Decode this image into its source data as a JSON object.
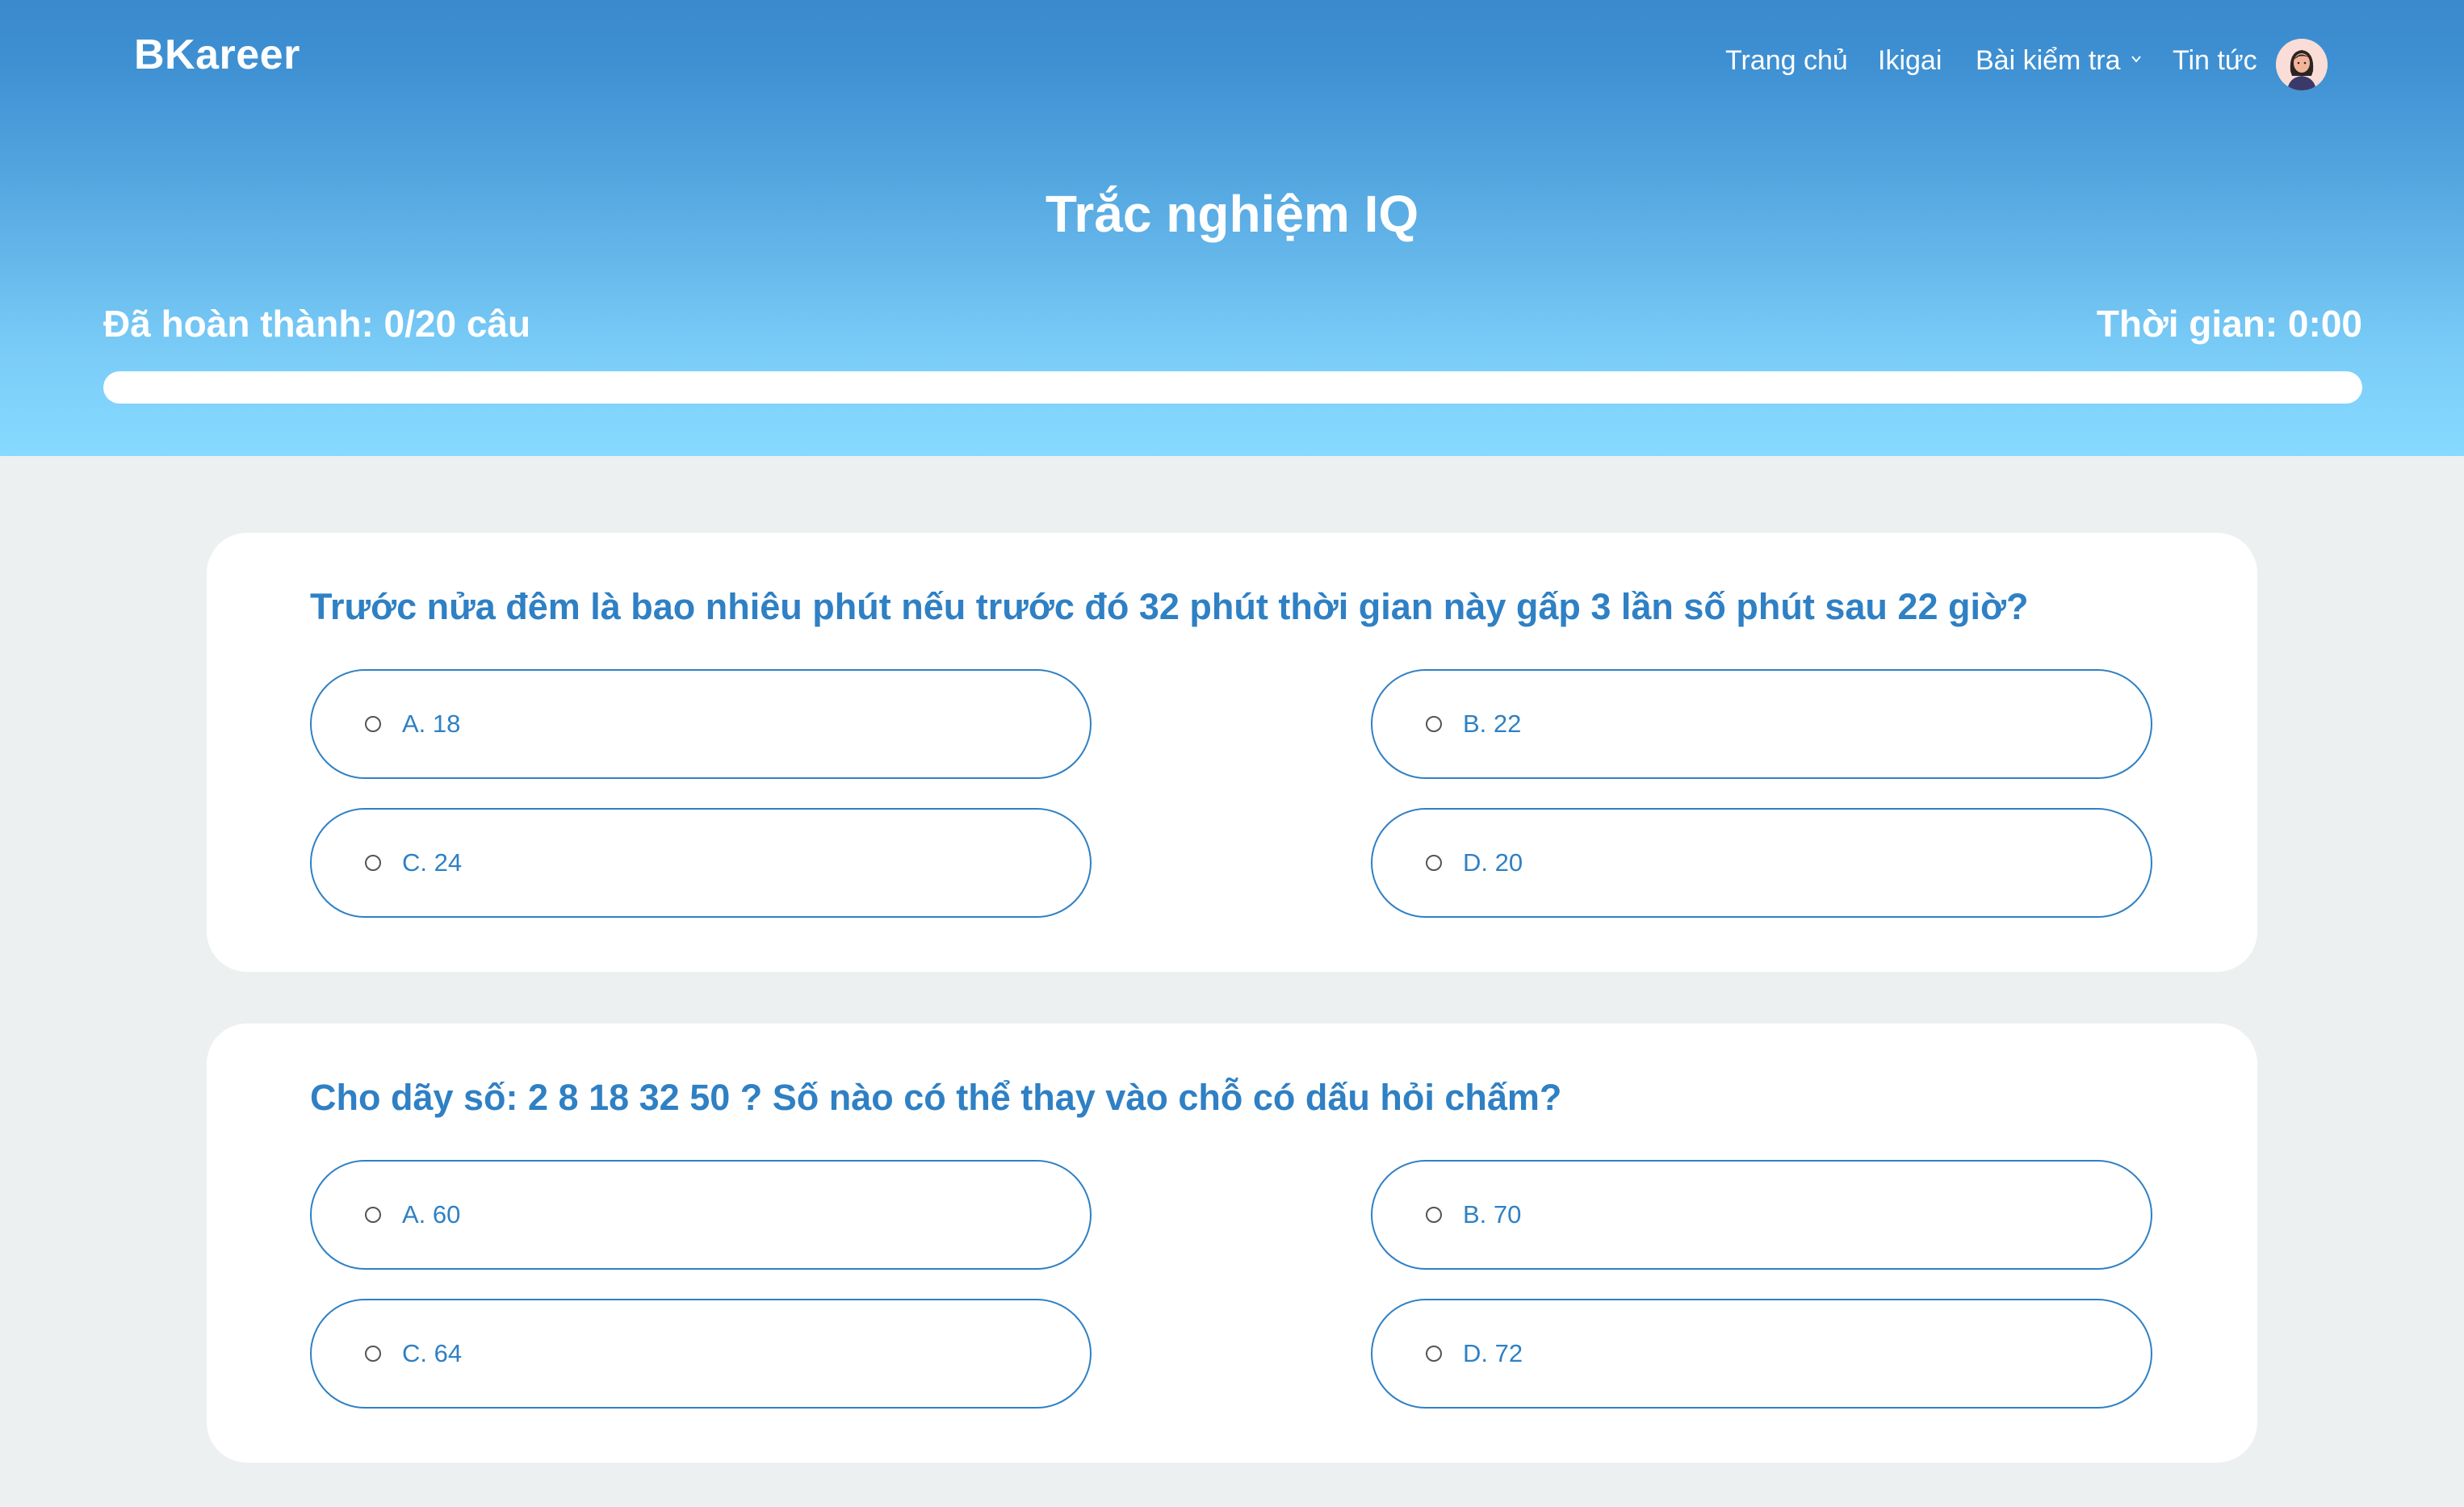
{
  "header": {
    "brand": "BKareer",
    "nav": [
      {
        "label": "Trang chủ"
      },
      {
        "label": "Ikigai"
      },
      {
        "label": "Bài kiểm tra",
        "has_dropdown": true
      },
      {
        "label": "Tin tức"
      }
    ],
    "avatar_icon": "user-avatar-icon"
  },
  "quiz": {
    "title": "Trắc nghiệm IQ",
    "completed_label": "Đã hoàn thành: 0/20 câu",
    "timer_label": "Thời gian: 0:00",
    "progress_fraction": 0
  },
  "questions": [
    {
      "text": "Trước nửa đêm là bao nhiêu phút nếu trước đó 32 phút thời gian này gấp 3 lần số phút sau 22 giờ?",
      "options": [
        "A. 18",
        "B. 22",
        "C. 24",
        "D. 20"
      ]
    },
    {
      "text": "Cho dãy số: 2 8 18 32 50 ? Số nào có thể thay vào chỗ có dấu hỏi chấm?",
      "options": [
        "A. 60",
        "B. 70",
        "C. 64",
        "D. 72"
      ]
    }
  ],
  "colors": {
    "accent": "#2f80c4",
    "header_top": "#3a8acd",
    "header_bottom": "#86daff",
    "page_bg": "#edf0f0"
  }
}
